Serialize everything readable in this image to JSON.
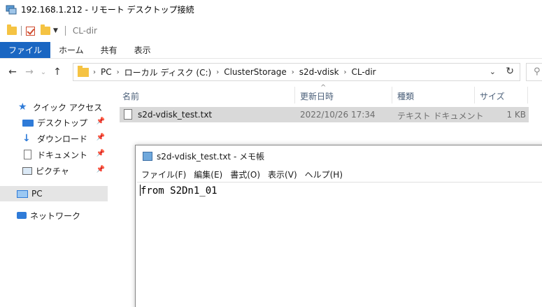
{
  "rdp": {
    "title": "192.168.1.212 - リモート デスクトップ接続"
  },
  "explorer": {
    "window_title": "CL-dir",
    "ribbon_tabs": [
      "ファイル",
      "ホーム",
      "共有",
      "表示"
    ],
    "breadcrumb": [
      "PC",
      "ローカル ディスク (C:)",
      "ClusterStorage",
      "s2d-vdisk",
      "CL-dir"
    ],
    "nav": {
      "quick_access": "クイック アクセス",
      "items": [
        "デスクトップ",
        "ダウンロード",
        "ドキュメント",
        "ピクチャ"
      ],
      "pc": "PC",
      "network": "ネットワーク"
    },
    "columns": [
      "名前",
      "更新日時",
      "種類",
      "サイズ"
    ],
    "files": [
      {
        "name": "s2d-vdisk_test.txt",
        "modified": "2022/10/26 17:34",
        "type": "テキスト ドキュメント",
        "size": "1 KB"
      }
    ]
  },
  "notepad": {
    "title": "s2d-vdisk_test.txt - メモ帳",
    "menu": [
      "ファイル(F)",
      "編集(E)",
      "書式(O)",
      "表示(V)",
      "ヘルプ(H)"
    ],
    "content": "from S2Dn1_01"
  },
  "colors": {
    "accent": "#1a66c2",
    "folder": "#f5c343",
    "selection": "#d9d9d9"
  }
}
